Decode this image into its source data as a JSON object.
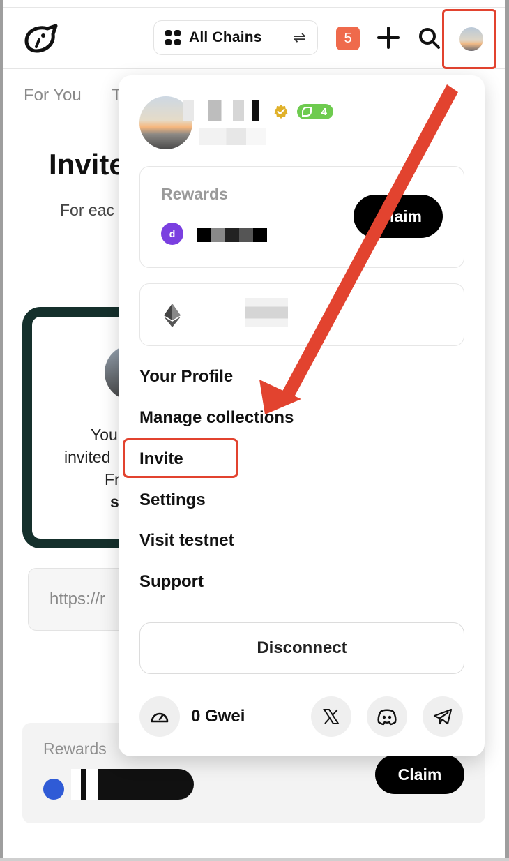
{
  "header": {
    "chain_selector_label": "All Chains",
    "notification_count": "5"
  },
  "tabs": [
    "For You",
    "T"
  ],
  "background": {
    "title": "Invite",
    "subtitle": "For eac",
    "card_lines": [
      "You",
      "invited",
      "Fr",
      "s"
    ],
    "url_text": "https://r",
    "rewards_label": "Rewards",
    "claim_label": "Claim"
  },
  "menu": {
    "profile": {
      "level": "4"
    },
    "rewards": {
      "label": "Rewards",
      "claim_label": "Claim"
    },
    "items": [
      {
        "label": "Your Profile"
      },
      {
        "label": "Manage collections"
      },
      {
        "label": "Invite"
      },
      {
        "label": "Settings"
      },
      {
        "label": "Visit testnet"
      },
      {
        "label": "Support"
      }
    ],
    "disconnect_label": "Disconnect",
    "gas": "0 Gwei"
  },
  "colors": {
    "annotation_red": "#e2432f",
    "notification_badge": "#ef6a4c",
    "level_badge": "#6ecb4f",
    "card_border": "#15302c"
  }
}
